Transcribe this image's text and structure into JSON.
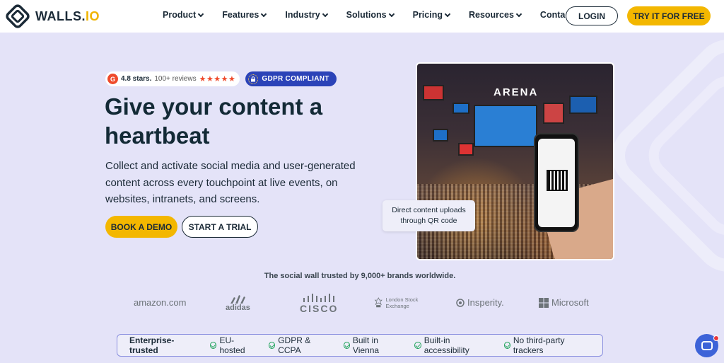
{
  "nav": {
    "logo_main": "WALLS.",
    "logo_accent": "IO",
    "items": [
      {
        "label": "Product",
        "dropdown": true
      },
      {
        "label": "Features",
        "dropdown": true
      },
      {
        "label": "Industry",
        "dropdown": true
      },
      {
        "label": "Solutions",
        "dropdown": true
      },
      {
        "label": "Pricing",
        "dropdown": true
      },
      {
        "label": "Resources",
        "dropdown": true
      },
      {
        "label": "Contact",
        "dropdown": false
      }
    ],
    "login_label": "LOGIN",
    "try_label": "TRY IT FOR FREE"
  },
  "hero": {
    "rating_letter": "G",
    "rating_stars_text": "4.8 stars.",
    "rating_reviews": "100+ reviews",
    "stars": "★★★★★",
    "gdpr_label": "GDPR COMPLIANT",
    "headline": "Give your content a heartbeat",
    "subtext": "Collect and activate social media and user-generated content across every touchpoint at live events, on websites, intranets, and screens.",
    "demo_label": "BOOK A DEMO",
    "trial_label": "START A TRIAL",
    "image_sign": "ARENA",
    "image_caption": "Direct content uploads through QR code"
  },
  "trust": {
    "headline": "The social wall trusted by 9,000+ brands worldwide.",
    "logos": [
      "amazon.com",
      "adidas",
      "CISCO",
      "London Stock Exchange",
      "Insperity.",
      "Microsoft"
    ]
  },
  "features_bar": {
    "first": "Enterprise-trusted",
    "items": [
      "EU-hosted",
      "GDPR & CCPA",
      "Built in Vienna",
      "Built-in accessibility",
      "No third-party trackers"
    ]
  },
  "colors": {
    "accent": "#f3b700",
    "background": "#e4e3f8",
    "gdpr_blue": "#2b43b8",
    "chat_blue": "#3d63d8"
  }
}
